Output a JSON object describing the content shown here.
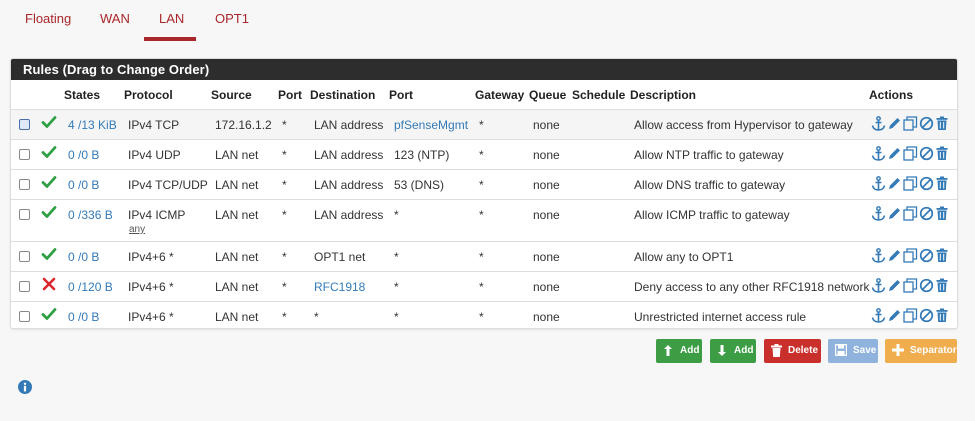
{
  "tabs": [
    {
      "label": "Floating"
    },
    {
      "label": "WAN"
    },
    {
      "label": "LAN",
      "active": true
    },
    {
      "label": "OPT1"
    }
  ],
  "panel": {
    "title": "Rules (Drag to Change Order)"
  },
  "columns": {
    "states": "States",
    "protocol": "Protocol",
    "source": "Source",
    "port": "Port",
    "destination": "Destination",
    "dest_port": "Port",
    "gateway": "Gateway",
    "queue": "Queue",
    "schedule": "Schedule",
    "description": "Description",
    "actions": "Actions"
  },
  "rules": [
    {
      "status": "pass",
      "states": "4 /13 KiB",
      "protocol": "IPv4 TCP",
      "protocol_sub": "",
      "source": "172.16.1.2",
      "port": "*",
      "destination": "LAN address",
      "dest_port": "pfSenseMgmt",
      "gateway": "*",
      "queue": "none",
      "schedule": "",
      "description": "Allow access from Hypervisor to gateway"
    },
    {
      "status": "pass",
      "states": "0 /0 B",
      "protocol": "IPv4 UDP",
      "protocol_sub": "",
      "source": "LAN net",
      "port": "*",
      "destination": "LAN address",
      "dest_port": "123 (NTP)",
      "gateway": "*",
      "queue": "none",
      "schedule": "",
      "description": "Allow NTP traffic to gateway"
    },
    {
      "status": "pass",
      "states": "0 /0 B",
      "protocol": "IPv4 TCP/UDP",
      "protocol_sub": "",
      "source": "LAN net",
      "port": "*",
      "destination": "LAN address",
      "dest_port": "53 (DNS)",
      "gateway": "*",
      "queue": "none",
      "schedule": "",
      "description": "Allow DNS traffic to gateway"
    },
    {
      "status": "pass",
      "states": "0 /336 B",
      "protocol": "IPv4 ICMP",
      "protocol_sub": "any",
      "source": "LAN net",
      "port": "*",
      "destination": "LAN address",
      "dest_port": "*",
      "gateway": "*",
      "queue": "none",
      "schedule": "",
      "description": "Allow ICMP traffic to gateway"
    },
    {
      "status": "pass",
      "states": "0 /0 B",
      "protocol": "IPv4+6 *",
      "protocol_sub": "",
      "source": "LAN net",
      "port": "*",
      "destination": "OPT1 net",
      "dest_port": "*",
      "gateway": "*",
      "queue": "none",
      "schedule": "",
      "description": "Allow any to OPT1"
    },
    {
      "status": "block",
      "states": "0 /120 B",
      "protocol": "IPv4+6 *",
      "protocol_sub": "",
      "source": "LAN net",
      "port": "*",
      "destination": "RFC1918",
      "dest_port": "*",
      "gateway": "*",
      "queue": "none",
      "schedule": "",
      "description": "Deny access to any other RFC1918 network"
    },
    {
      "status": "pass",
      "states": "0 /0 B",
      "protocol": "IPv4+6 *",
      "protocol_sub": "",
      "source": "LAN net",
      "port": "*",
      "destination": "*",
      "dest_port": "*",
      "gateway": "*",
      "queue": "none",
      "schedule": "",
      "description": "Unrestricted internet access rule"
    }
  ],
  "buttons": {
    "add_top": "Add",
    "add_bottom": "Add",
    "delete": "Delete",
    "save": "Save",
    "separator": "Separator"
  },
  "colors": {
    "accent": "#a9262b",
    "link": "#337ab7",
    "pass": "#2ea043",
    "block": "#d9262e",
    "btn_add": "#3c9d45",
    "btn_delete": "#c9302c",
    "btn_save": "#8fb3dc",
    "btn_separator": "#f0ad4e"
  },
  "icons": [
    "check-icon",
    "x-icon",
    "anchor-icon",
    "pencil-icon",
    "copy-icon",
    "disable-icon",
    "trash-icon",
    "info-icon"
  ]
}
